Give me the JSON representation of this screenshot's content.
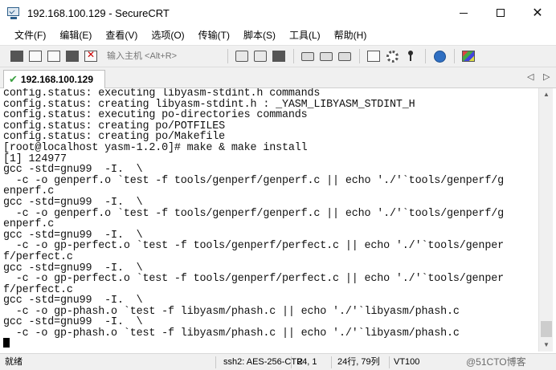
{
  "window": {
    "title": "192.168.100.129 - SecureCRT",
    "icon": "securecrt-app-icon"
  },
  "window_controls": {
    "minimize": "minimize-icon",
    "maximize": "maximize-icon",
    "close": "close-icon",
    "close_glyph": "✕"
  },
  "menu": {
    "items": [
      "文件(F)",
      "编辑(E)",
      "查看(V)",
      "选项(O)",
      "传输(T)",
      "脚本(S)",
      "工具(L)",
      "帮助(H)"
    ]
  },
  "toolbar": {
    "quick_connect_placeholder": "输入主机 <Alt+R>",
    "icons": [
      "connect-icon",
      "quick-connect-icon",
      "connect-tab-icon",
      "reconnect-icon",
      "disconnect-icon",
      "copy-icon",
      "paste-icon",
      "find-icon",
      "print-icon",
      "print-setup-icon",
      "print-selection-icon",
      "session-options-icon",
      "global-options-icon",
      "keymap-icon",
      "help-icon",
      "sftp-icon"
    ]
  },
  "tabs": [
    {
      "label": "192.168.100.129",
      "status_icon": "connected-check-icon",
      "check": "✔"
    }
  ],
  "tab_nav": {
    "prev": "◁",
    "next": "▷"
  },
  "terminal": {
    "lines": [
      "config.status: executing libyasm-stdint.h commands",
      "config.status: creating libyasm-stdint.h : _YASM_LIBYASM_STDINT_H",
      "config.status: executing po-directories commands",
      "config.status: creating po/POTFILES",
      "config.status: creating po/Makefile",
      "[root@localhost yasm-1.2.0]# make & make install",
      "[1] 124977",
      "gcc -std=gnu99  -I.  \\",
      "  -c -o genperf.o `test -f tools/genperf/genperf.c || echo './'`tools/genperf/g",
      "enperf.c",
      "gcc -std=gnu99  -I.  \\",
      "  -c -o genperf.o `test -f tools/genperf/genperf.c || echo './'`tools/genperf/g",
      "enperf.c",
      "gcc -std=gnu99  -I.  \\",
      "  -c -o gp-perfect.o `test -f tools/genperf/perfect.c || echo './'`tools/genper",
      "f/perfect.c",
      "gcc -std=gnu99  -I.  \\",
      "  -c -o gp-perfect.o `test -f tools/genperf/perfect.c || echo './'`tools/genper",
      "f/perfect.c",
      "gcc -std=gnu99  -I.  \\",
      "  -c -o gp-phash.o `test -f libyasm/phash.c || echo './'`libyasm/phash.c",
      "gcc -std=gnu99  -I.  \\",
      "  -c -o gp-phash.o `test -f libyasm/phash.c || echo './'`libyasm/phash.c"
    ]
  },
  "scrollbar": {
    "up": "▲",
    "down": "▼"
  },
  "statusbar": {
    "ready": "就绪",
    "cipher": "ssh2: AES-256-CTR",
    "cursor_pos": "24,  1",
    "size": "24行, 79列",
    "emulation": "VT100",
    "watermark": "@51CTO博客"
  }
}
